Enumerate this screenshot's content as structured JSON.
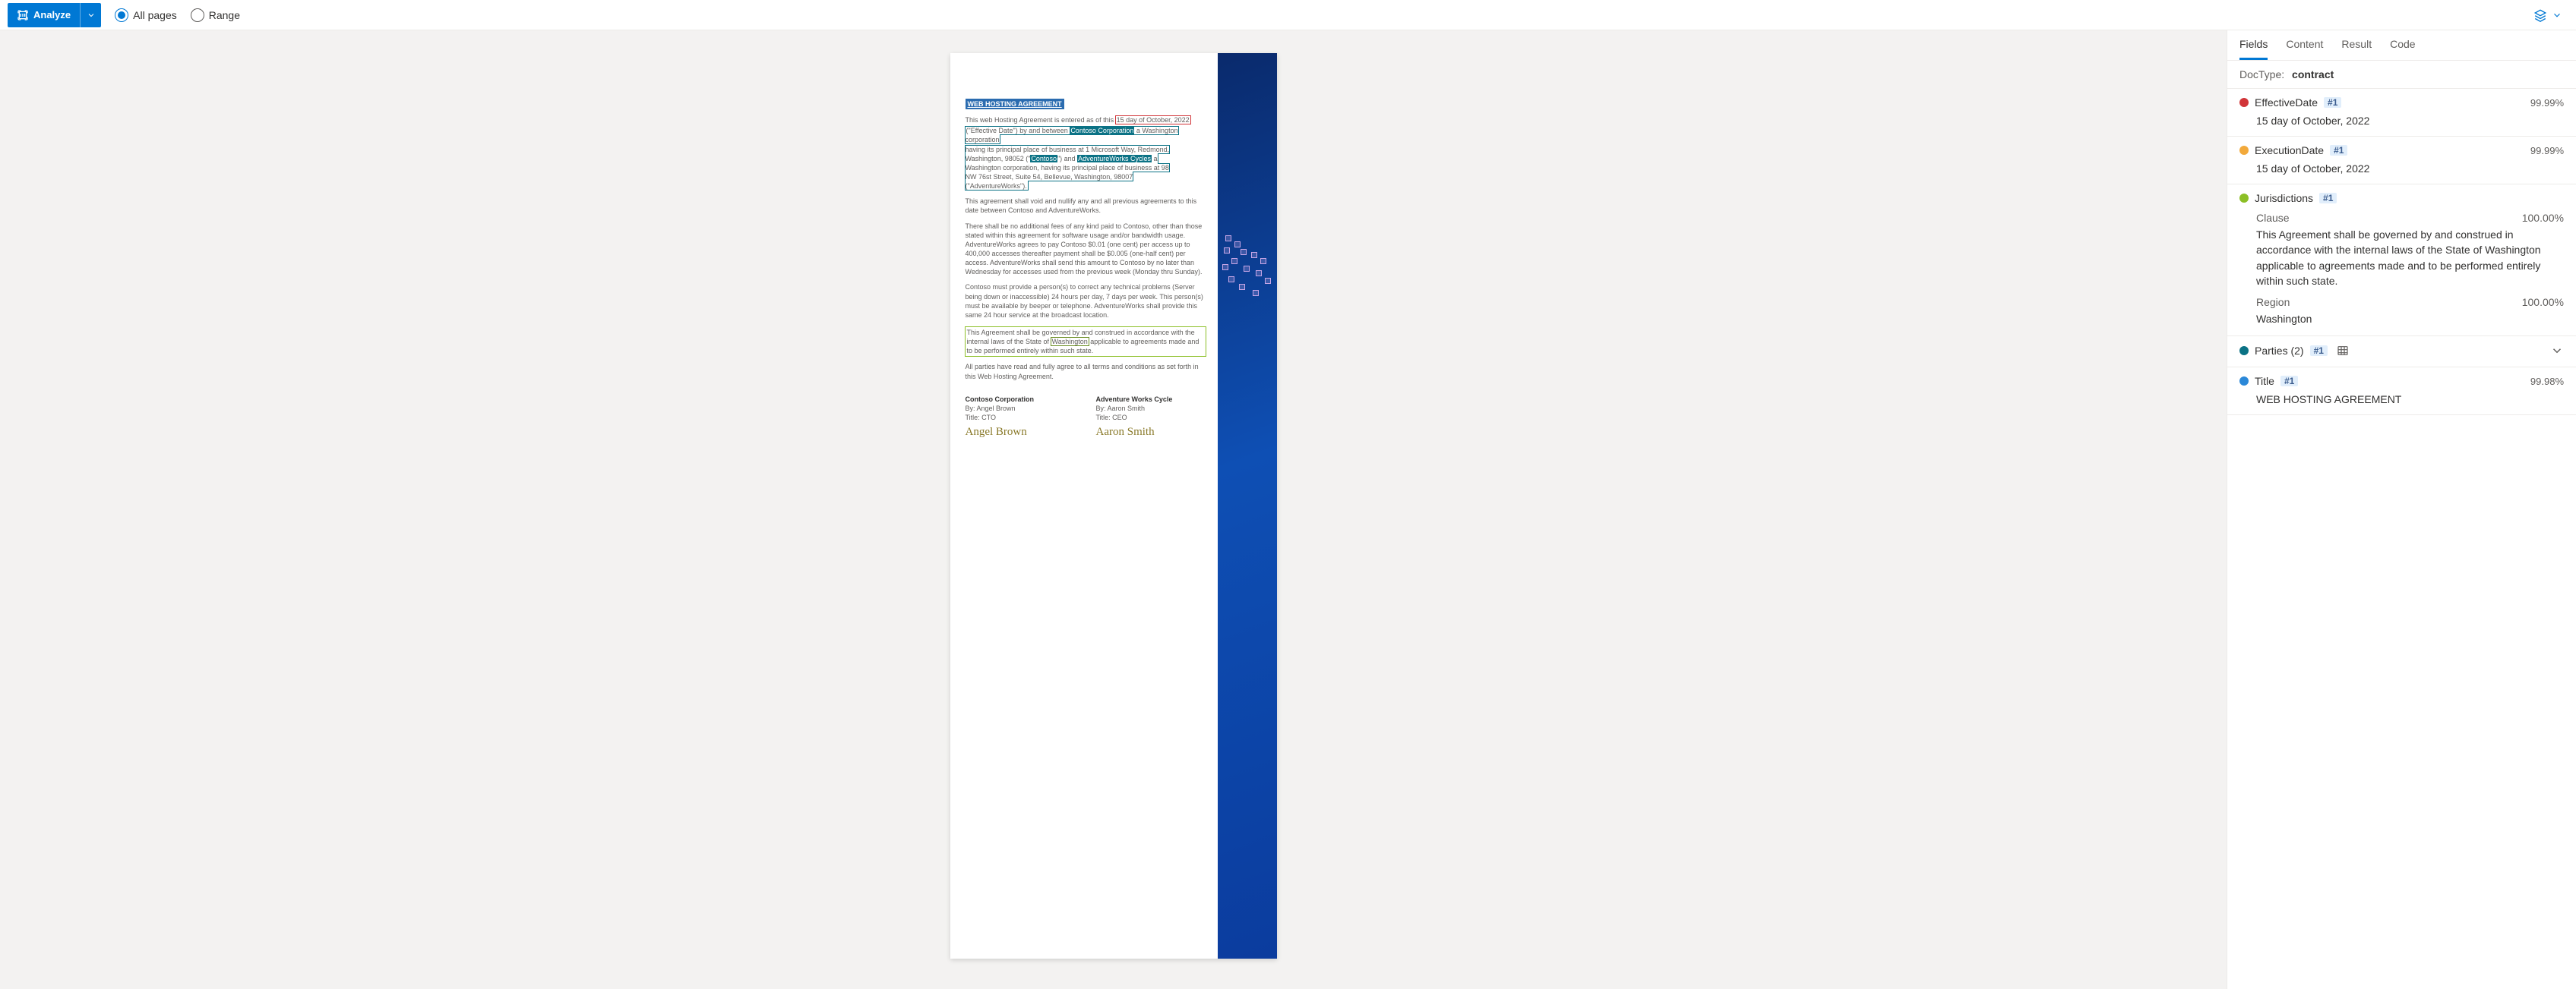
{
  "toolbar": {
    "analyze_label": "Analyze",
    "all_pages_label": "All pages",
    "range_label": "Range",
    "page_scope": "all"
  },
  "doc": {
    "title": "WEB HOSTING AGREEMENT",
    "intro_a": "This web Hosting Agreement is entered as of this ",
    "intro_date": "15 day of October, 2022",
    "line2_a": "(\"Effective Date\") by and between ",
    "line2_company": "Contoso Corporation",
    "line2_b": " a Washington corporation",
    "line3": "having its principal place of business at 1 Microsoft Way, Redmond,",
    "line4_a": "Washington, 98052 (\"",
    "line4_contoso": "Contoso",
    "line4_b": "\") and ",
    "line4_aw": "AdventureWorks Cycles",
    "line4_c": " a",
    "line5": "Washington corporation, having its principal place of business at 98",
    "line6": "NW 76st Street, Suite 54, Bellevue, Washington, 98007",
    "line7": "(\"AdventureWorks\").",
    "para2": "This agreement shall void and nullify any and all previous agreements to this date between Contoso and AdventureWorks.",
    "para3": "There shall be no additional fees of any kind paid to Contoso, other than those stated within this agreement for software usage and/or bandwidth usage. AdventureWorks agrees to pay Contoso $0.01 (one cent) per access up to 400,000 accesses thereafter payment shall be $0.005 (one-half cent) per access. AdventureWorks shall send this amount to Contoso by no later than Wednesday for accesses used from the previous week (Monday thru Sunday).",
    "para4": "Contoso must provide a person(s) to correct any technical problems (Server being down or inaccessible) 24 hours per day, 7 days per week. This person(s) must be available by beeper or telephone. AdventureWorks shall provide this same 24 hour service at the broadcast location.",
    "clause_a": "This Agreement shall be governed by and construed in accordance with the internal laws of the State of ",
    "clause_region": "Washington",
    "clause_b": " applicable to agreements made and to be performed entirely within such state.",
    "closing": "All parties have read and fully agree to all terms and conditions as set forth in this Web Hosting Agreement.",
    "sig1_head": "Contoso Corporation",
    "sig1_by": "By: Angel Brown",
    "sig1_title": "Title: CTO",
    "sig1_sig": "Angel Brown",
    "sig2_head": "Adventure Works Cycle",
    "sig2_by": "By: Aaron Smith",
    "sig2_title": "Title: CEO",
    "sig2_sig": "Aaron Smith"
  },
  "panel": {
    "tabs": [
      "Fields",
      "Content",
      "Result",
      "Code"
    ],
    "active_tab": 0,
    "doctype_label": "DocType:",
    "doctype_value": "contract",
    "fields": [
      {
        "color": "#d13438",
        "name": "EffectiveDate",
        "badge": "#1",
        "confidence": "99.99%",
        "value": "15 day of October, 2022"
      },
      {
        "color": "#f2a93b",
        "name": "ExecutionDate",
        "badge": "#1",
        "confidence": "99.99%",
        "value": "15 day of October, 2022"
      },
      {
        "color": "#8cbf26",
        "name": "Jurisdictions",
        "badge": "#1",
        "subs": [
          {
            "k": "Clause",
            "c": "100.00%",
            "v": "This Agreement shall be governed by and construed in accordance with the internal laws of the State of Washington applicable to agreements made and to be performed entirely within such state."
          },
          {
            "k": "Region",
            "c": "100.00%",
            "v": "Washington"
          }
        ]
      },
      {
        "color": "#0b7285",
        "name": "Parties (2)",
        "badge": "#1",
        "has_table_icon": true,
        "expandable": true
      },
      {
        "color": "#2b88d8",
        "name": "Title",
        "badge": "#1",
        "confidence": "99.98%",
        "value": "WEB HOSTING AGREEMENT"
      }
    ]
  }
}
